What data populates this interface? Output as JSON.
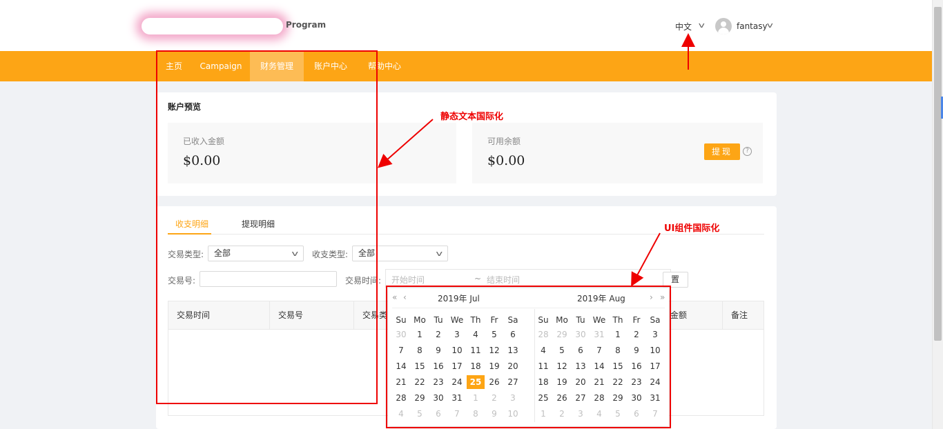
{
  "header": {
    "logo_text": "Program",
    "language": "中文",
    "username": "fantasy"
  },
  "nav": {
    "items": [
      {
        "label": "主页",
        "active": false
      },
      {
        "label": "Campaign",
        "active": false
      },
      {
        "label": "财务管理",
        "active": true
      },
      {
        "label": "账户中心",
        "active": false
      },
      {
        "label": "帮助中心",
        "active": false
      }
    ]
  },
  "overview": {
    "title": "账户预览",
    "received_label": "已收入金额",
    "received_value": "$0.00",
    "available_label": "可用余额",
    "available_value": "$0.00",
    "withdraw_button": "提现",
    "help_icon": "?"
  },
  "tabs": [
    {
      "label": "收支明细",
      "active": true
    },
    {
      "label": "提现明细",
      "active": false
    }
  ],
  "filters": {
    "trade_type_label": "交易类型:",
    "trade_type_value": "全部",
    "io_type_label": "收支类型:",
    "io_type_value": "全部",
    "trade_no_label": "交易号:",
    "trade_no_value": "",
    "trade_time_label": "交易时间:",
    "start_placeholder": "开始时间",
    "range_sep": "~",
    "end_placeholder": "结束时间",
    "reset_button": "置"
  },
  "table": {
    "columns": [
      "交易时间",
      "交易号",
      "交易类",
      "金额",
      "备注"
    ]
  },
  "calendar": {
    "left_title": "2019年 Jul",
    "right_title": "2019年 Aug",
    "nav": {
      "prev_year": "«",
      "prev_month": "‹",
      "next_month": "›",
      "next_year": "»"
    },
    "weekdays": [
      "Su",
      "Mo",
      "Tu",
      "We",
      "Th",
      "Fr",
      "Sa"
    ],
    "left_days": [
      [
        30,
        1,
        2,
        3,
        4,
        5,
        6
      ],
      [
        7,
        8,
        9,
        10,
        11,
        12,
        13
      ],
      [
        14,
        15,
        16,
        17,
        18,
        19,
        20
      ],
      [
        21,
        22,
        23,
        24,
        25,
        26,
        27
      ],
      [
        28,
        29,
        30,
        31,
        1,
        2,
        3
      ],
      [
        4,
        5,
        6,
        7,
        8,
        9,
        10
      ]
    ],
    "right_days": [
      [
        28,
        29,
        30,
        31,
        1,
        2,
        3
      ],
      [
        4,
        5,
        6,
        7,
        8,
        9,
        10
      ],
      [
        11,
        12,
        13,
        14,
        15,
        16,
        17
      ],
      [
        18,
        19,
        20,
        21,
        22,
        23,
        24
      ],
      [
        25,
        26,
        27,
        28,
        29,
        30,
        31
      ],
      [
        1,
        2,
        3,
        4,
        5,
        6,
        7
      ]
    ],
    "selected_day": 25
  },
  "annotations": {
    "static_text": "静态文本国际化",
    "ui_component": "UI组件国际化",
    "color": "#e00000"
  },
  "colors": {
    "brand": "#fda515",
    "nav_active": "#fdbc55"
  }
}
